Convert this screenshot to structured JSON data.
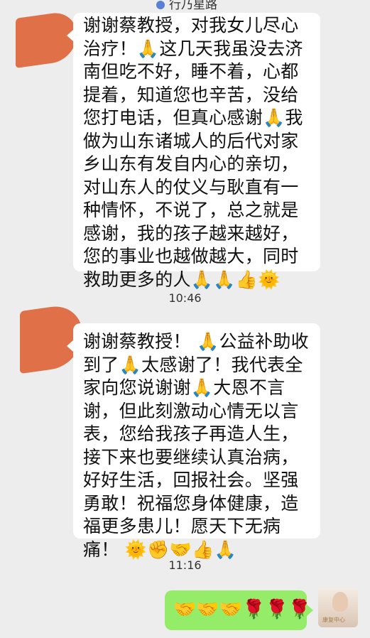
{
  "header": {
    "title": "行乃星路"
  },
  "messages": [
    {
      "side": "left",
      "text": "谢谢蔡教授，对我女儿尽心治疗！🙏这几天我虽没去济南但吃不好，睡不着，心都提着，知道您也辛苦，没给您打电话，但真心感谢🙏我做为山东诸城人的后代对家乡山东有发自内心的亲切，对山东人的仗义与耿直有一种情怀，不说了，总之就是感谢，我的孩子越来越好，您的事业也越做越大，同时救助更多的人🙏🙏👍🌞"
    },
    {
      "side": "left",
      "text": "谢谢蔡教授！ 🙏公益补助收到了🙏太感谢了！我代表全家向您说谢谢🙏大恩不言谢，但此刻激动心情无以言表，您给我孩子再造人生，接下来也要继续认真治病，好好生活，回报社会。坚强勇敢！祝福您身体健康，造福更多患儿！愿天下无病痛！ 🌞✊🤝👍🙏"
    },
    {
      "side": "right",
      "text": "🤝🤝🤝🌹🌹🌹"
    }
  ],
  "timestamps": [
    "10:46",
    "11:16"
  ],
  "self_avatar": {
    "caption": "康复中心"
  },
  "colors": {
    "bubble_self": "#95ec69",
    "bubble_other": "#ffffff",
    "background": "#ededed",
    "redaction": "#e07048"
  }
}
